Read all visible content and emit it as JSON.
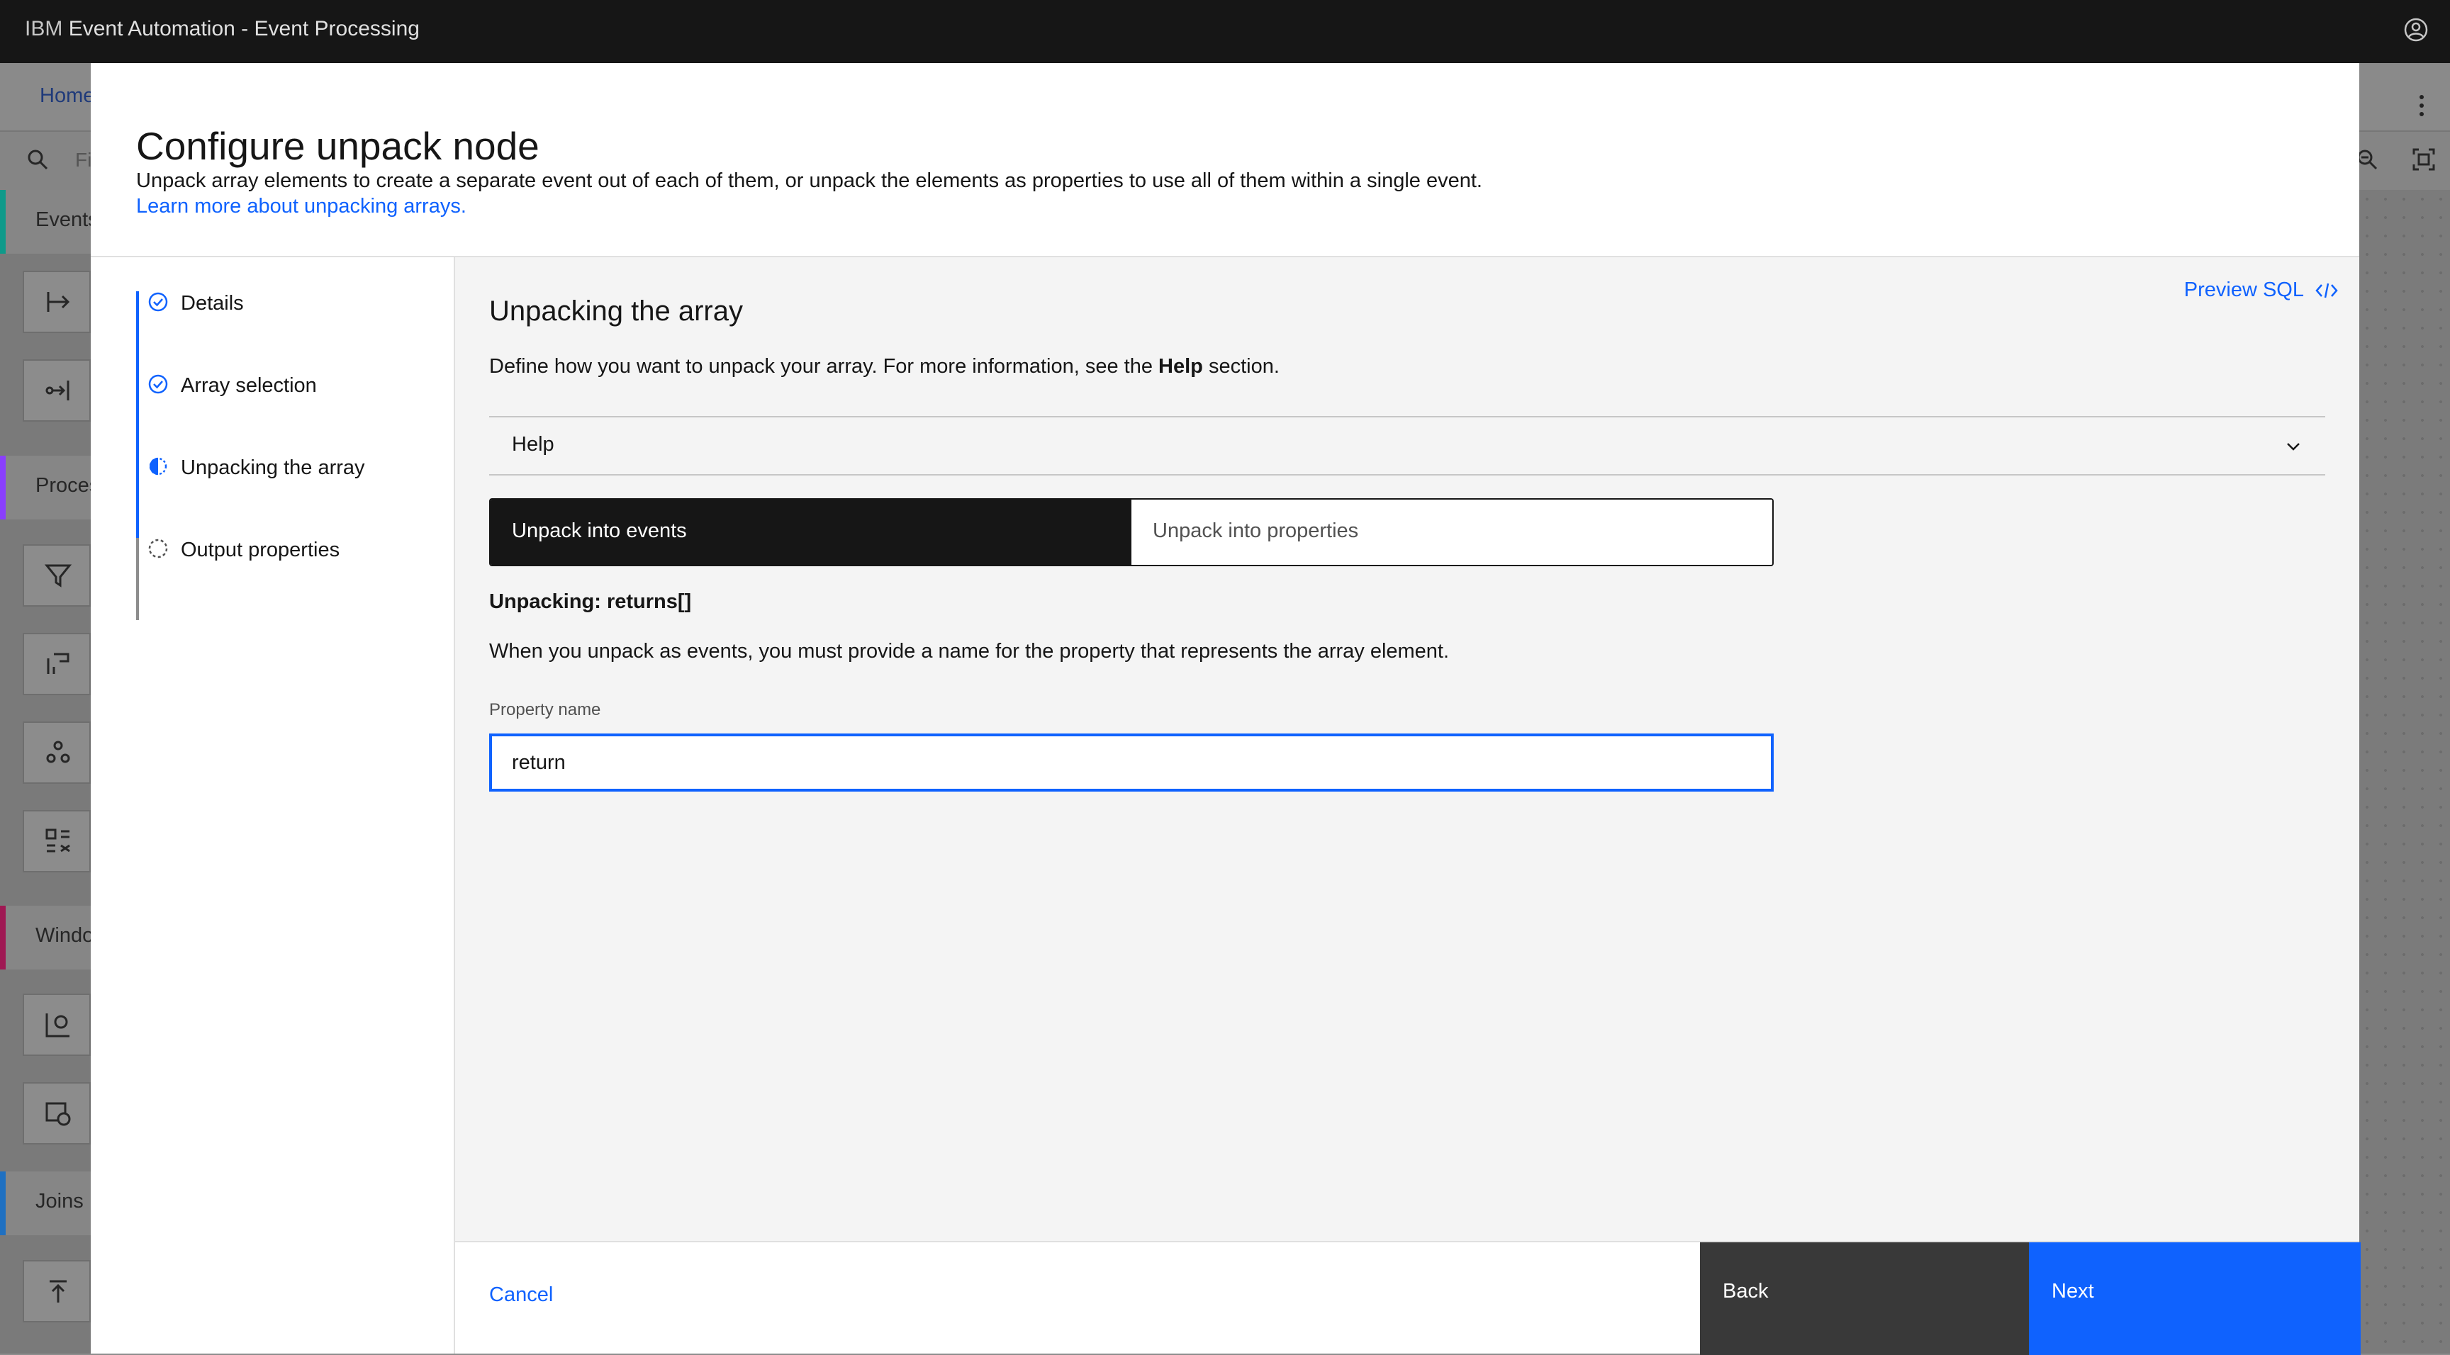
{
  "header": {
    "title_prefix": "IBM",
    "title_rest": "Event Automation - Event Processing"
  },
  "background": {
    "home_tab": "Home",
    "search_placeholder": "Fi",
    "categories": [
      "Events",
      "Proces",
      "Windo",
      "Joins"
    ],
    "category_colors": [
      "#0f9a8a",
      "#8a3ffc",
      "#9f1853",
      "#1f70c1"
    ]
  },
  "modal": {
    "title": "Configure unpack node",
    "description": "Unpack array elements to create a separate event out of each of them, or unpack the elements as properties to use all of them within a single event.",
    "learn_more": "Learn more about unpacking arrays."
  },
  "steps": [
    {
      "label": "Details",
      "state": "complete"
    },
    {
      "label": "Array selection",
      "state": "complete"
    },
    {
      "label": "Unpacking the array",
      "state": "current"
    },
    {
      "label": "Output properties",
      "state": "incomplete"
    }
  ],
  "content": {
    "preview_sql": "Preview SQL",
    "section_title": "Unpacking the array",
    "section_desc_before": "Define how you want to unpack your array. For more information, see the",
    "section_desc_bold": "Help",
    "section_desc_after": "section.",
    "help_label": "Help",
    "switcher": {
      "option_events": "Unpack into events",
      "option_properties": "Unpack into properties",
      "selected": "Unpack into events"
    },
    "unpacking_label": "Unpacking: returns[]",
    "unpack_desc": "When you unpack as events, you must provide a name for the property that represents the array element.",
    "property_name_label": "Property name",
    "property_name_value": "return"
  },
  "footer": {
    "cancel": "Cancel",
    "back": "Back",
    "next": "Next"
  },
  "colors": {
    "accent": "#0f62fe",
    "header_bg": "#161616",
    "back_bg": "#393939"
  }
}
